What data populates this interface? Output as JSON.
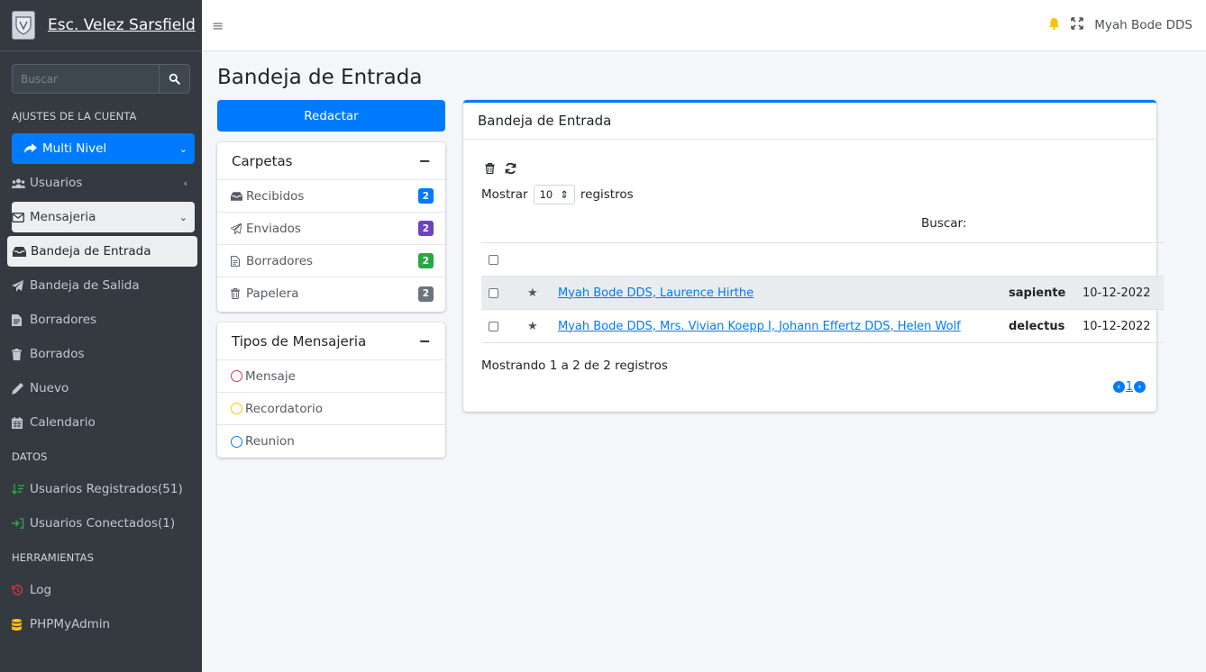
{
  "brand": {
    "name": "Esc. Velez Sarsfield"
  },
  "sidebar": {
    "search_placeholder": "Buscar",
    "section_account": "AJUSTES DE LA CUENTA",
    "items": [
      {
        "label": "Multi Nivel"
      },
      {
        "label": "Usuarios"
      },
      {
        "label": "Mensajeria"
      },
      {
        "label": "Bandeja de Entrada"
      },
      {
        "label": "Bandeja de Salida"
      },
      {
        "label": "Borradores"
      },
      {
        "label": "Borrados"
      },
      {
        "label": "Nuevo"
      },
      {
        "label": "Calendario"
      }
    ],
    "section_data": "DATOS",
    "data_items": [
      {
        "label": "Usuarios Registrados(51)"
      },
      {
        "label": "Usuarios Conectados(1)"
      }
    ],
    "section_tools": "HERRAMIENTAS",
    "tool_items": [
      {
        "label": "Log"
      },
      {
        "label": "PHPMyAdmin"
      }
    ]
  },
  "topbar": {
    "user": "Myah Bode DDS"
  },
  "page": {
    "title": "Bandeja de Entrada",
    "compose_label": "Redactar"
  },
  "folders": {
    "title": "Carpetas",
    "items": [
      {
        "label": "Recibidos",
        "count": "2",
        "color": "#007bff"
      },
      {
        "label": "Enviados",
        "count": "2",
        "color": "#6f42c1"
      },
      {
        "label": "Borradores",
        "count": "2",
        "color": "#28a745"
      },
      {
        "label": "Papelera",
        "count": "2",
        "color": "#6c757d"
      }
    ]
  },
  "types": {
    "title": "Tipos de Mensajeria",
    "items": [
      {
        "label": "Mensaje",
        "color": "#dc3545"
      },
      {
        "label": "Recordatorio",
        "color": "#ffc107"
      },
      {
        "label": "Reunion",
        "color": "#007bff"
      }
    ]
  },
  "inbox": {
    "title": "Bandeja de Entrada",
    "show_prefix": "Mostrar",
    "page_size": "10",
    "show_suffix": "registros",
    "search_label": "Buscar:",
    "rows": [
      {
        "from": "Myah Bode DDS, Laurence Hirthe",
        "subject": "sapiente",
        "date": "10-12-2022"
      },
      {
        "from": "Myah Bode DDS, Mrs. Vivian Koepp I, Johann Effertz DDS, Helen Wolf",
        "subject": "delectus",
        "date": "10-12-2022"
      }
    ],
    "info": "Mostrando 1 a 2 de 2 registros",
    "current_page": "1"
  }
}
